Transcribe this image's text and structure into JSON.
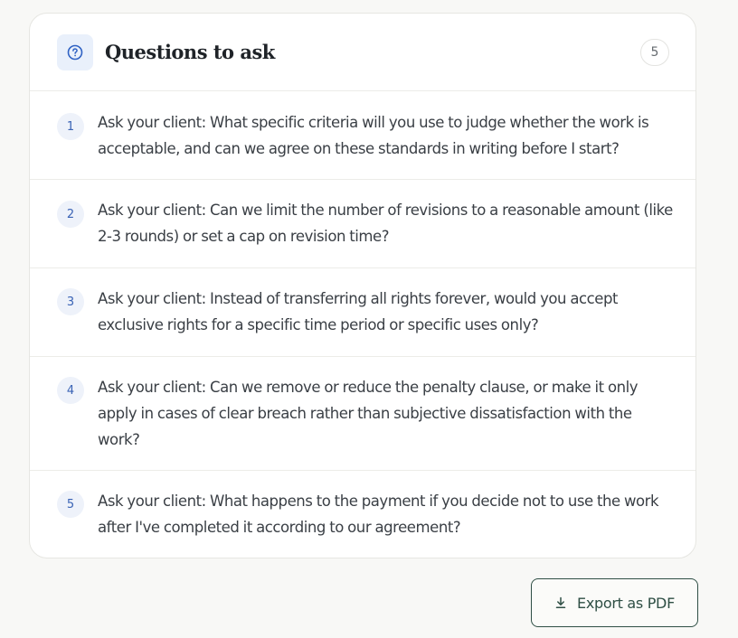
{
  "card": {
    "title": "Questions to ask",
    "icon": "help-circle-icon",
    "count": "5",
    "accent_color": "#3a63b5"
  },
  "questions": [
    {
      "number": "1",
      "text": "Ask your client: What specific criteria will you use to judge whether the work is acceptable, and can we agree on these standards in writing before I start?"
    },
    {
      "number": "2",
      "text": "Ask your client: Can we limit the number of revisions to a reasonable amount (like 2-3 rounds) or set a cap on revision time?"
    },
    {
      "number": "3",
      "text": "Ask your client: Instead of transferring all rights forever, would you accept exclusive rights for a specific time period or specific uses only?"
    },
    {
      "number": "4",
      "text": "Ask your client: Can we remove or reduce the penalty clause, or make it only apply in cases of clear breach rather than subjective dissatisfaction with the work?"
    },
    {
      "number": "5",
      "text": "Ask your client: What happens to the payment if you decide not to use the work after I've completed it according to our agreement?"
    }
  ],
  "export": {
    "label": "Export as PDF",
    "icon": "download-icon",
    "color": "#2f4f45"
  }
}
